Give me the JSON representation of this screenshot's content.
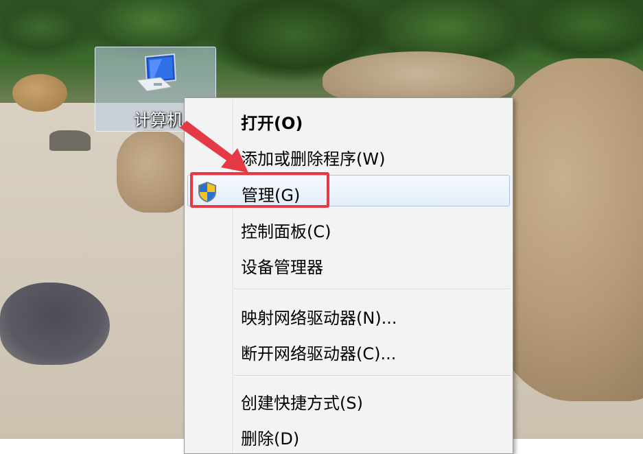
{
  "desktop": {
    "icon_label": "计算机",
    "icon_name": "computer-icon"
  },
  "context_menu": {
    "items": [
      {
        "label": "打开(O)",
        "bold": true
      },
      {
        "label": "添加或删除程序(W)"
      },
      {
        "label": "管理(G)",
        "icon": "shield-icon",
        "highlighted": true
      },
      {
        "label": "控制面板(C)"
      },
      {
        "label": "设备管理器"
      },
      {
        "label": "映射网络驱动器(N)..."
      },
      {
        "label": "断开网络驱动器(C)..."
      },
      {
        "label": "创建快捷方式(S)"
      },
      {
        "label": "删除(D)"
      }
    ]
  },
  "annotation": {
    "color": "#e53a45",
    "highlight_target": "管理(G)"
  }
}
